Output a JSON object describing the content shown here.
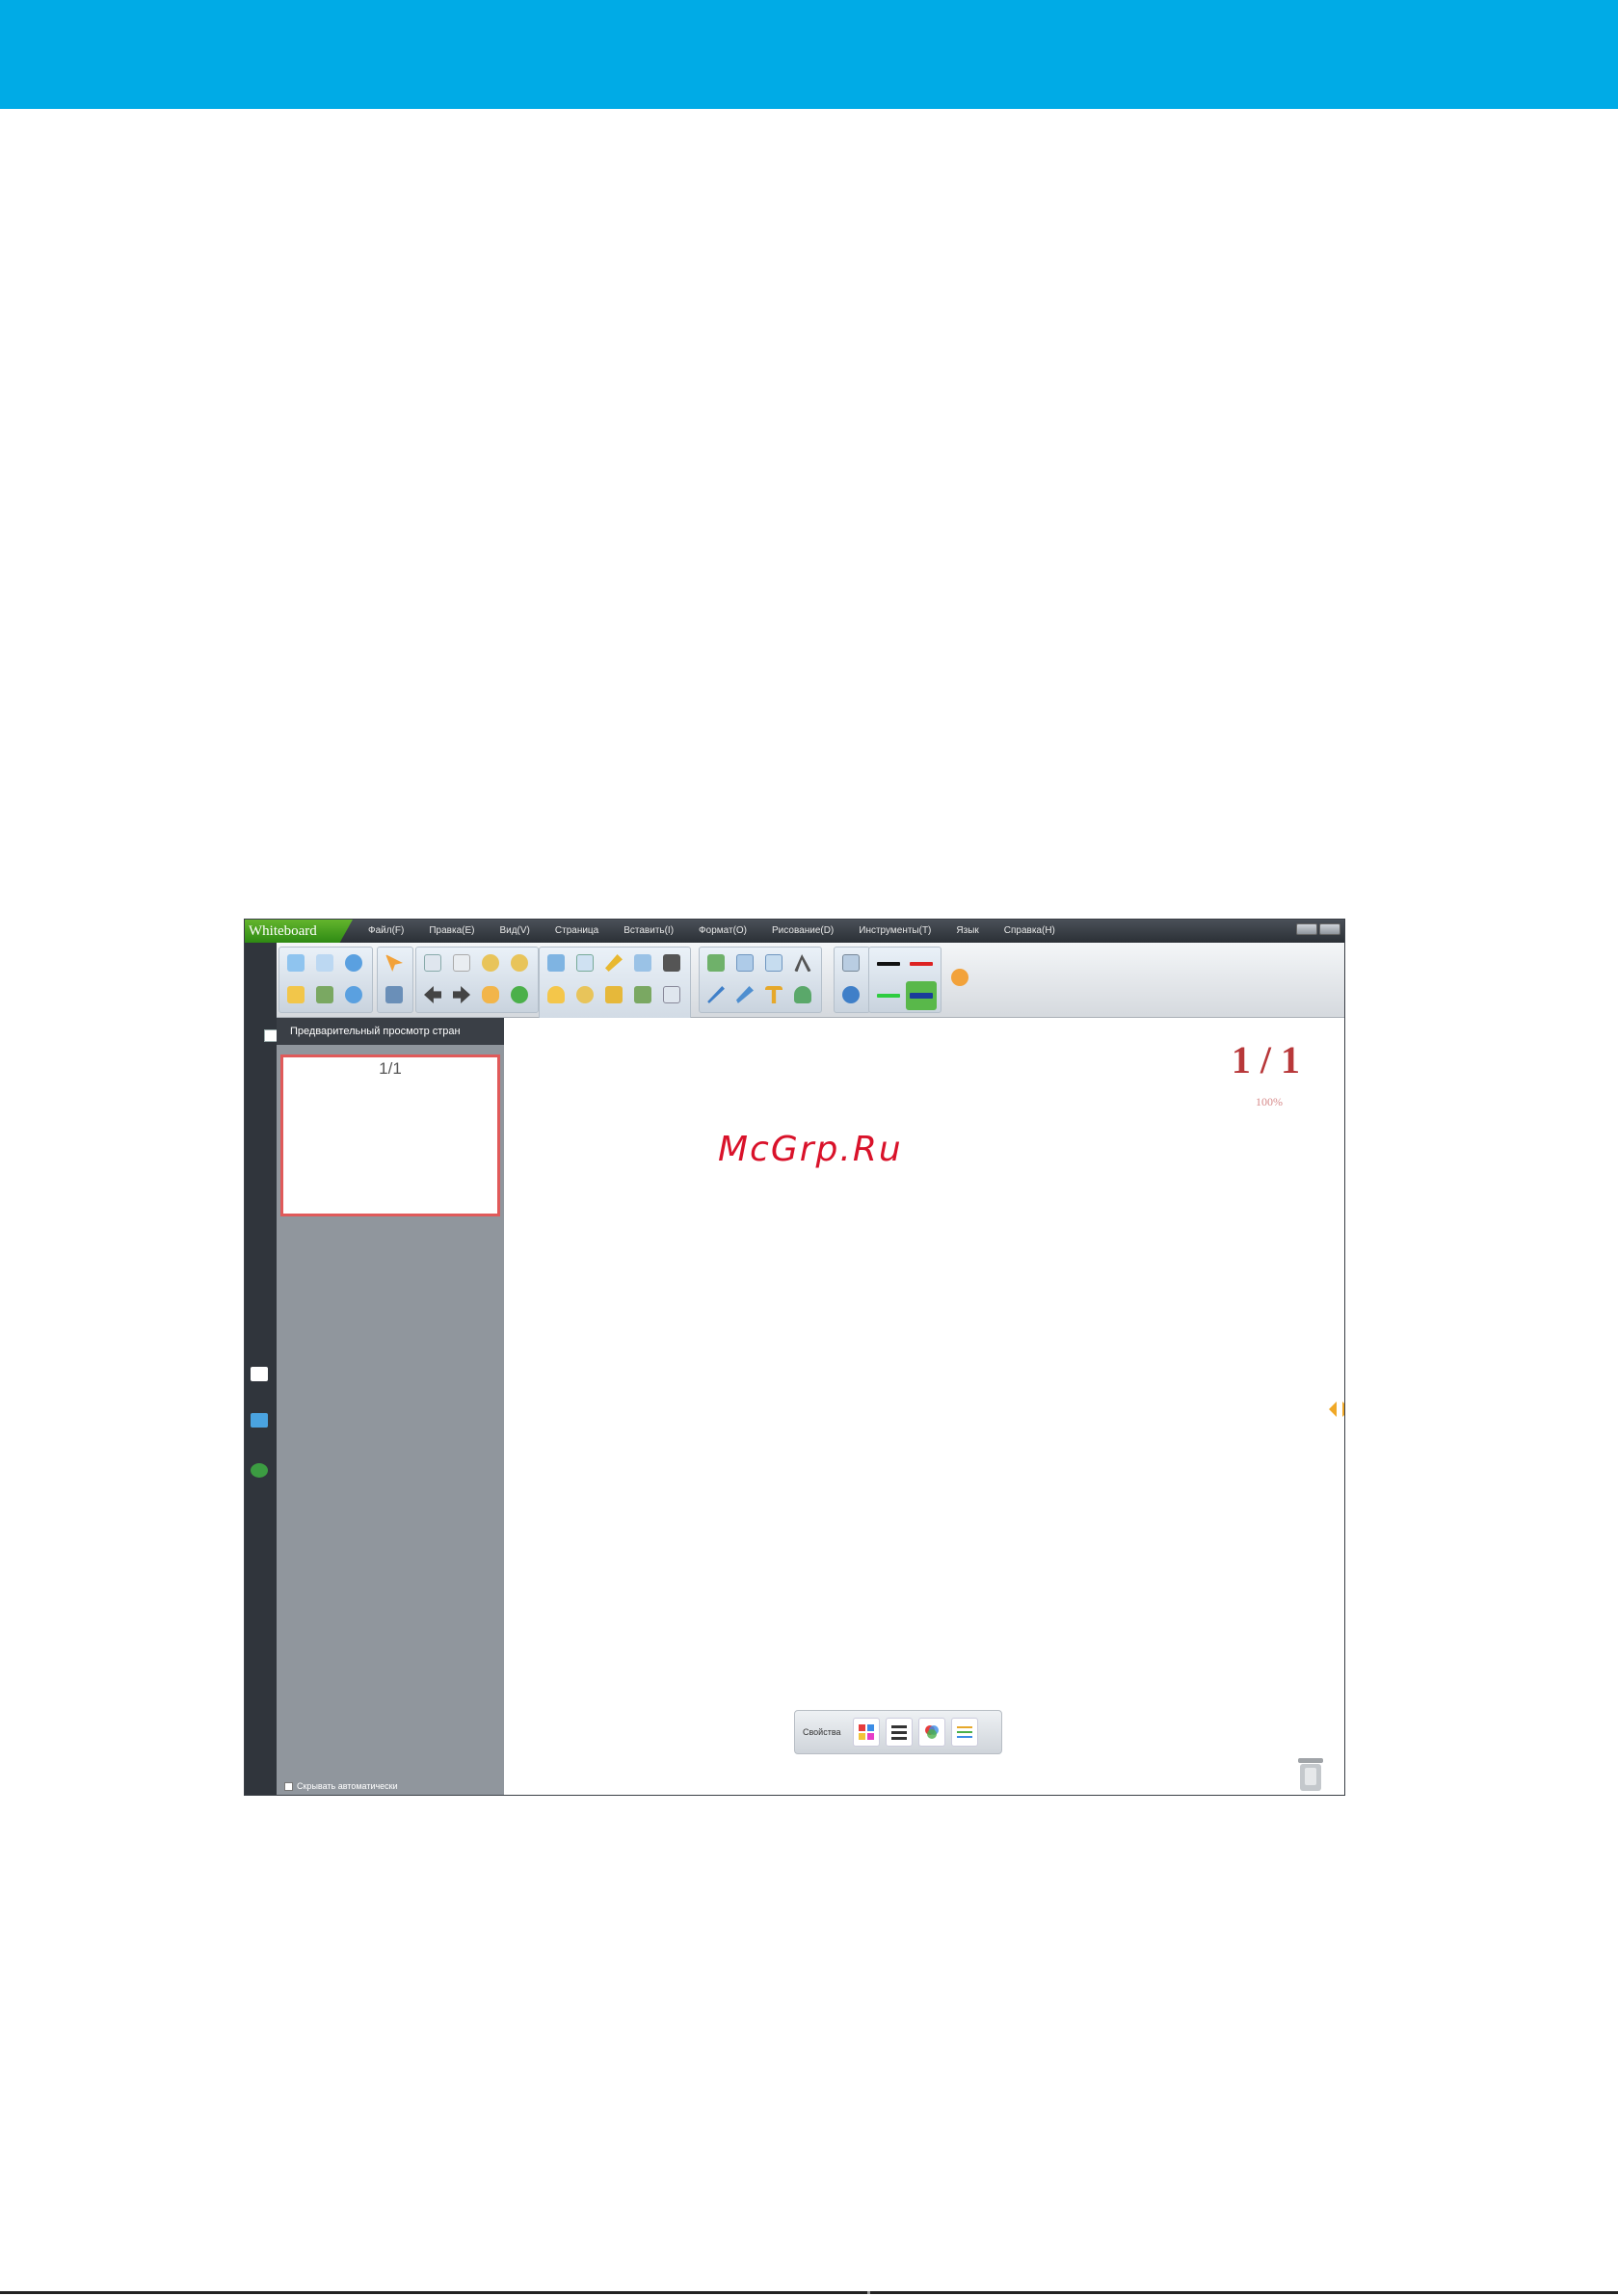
{
  "watermark": "McGrp.Ru",
  "app": {
    "brand": "Whiteboard",
    "menu": [
      "Файл(F)",
      "Правка(E)",
      "Вид(V)",
      "Страница",
      "Вставить(I)",
      "Формат(O)",
      "Рисование(D)",
      "Инструменты(T)",
      "Язык",
      "Справка(H)"
    ],
    "preview_title": "Предварительный просмотр стран",
    "thumbnail_label": "1/1",
    "autohide_label": "Скрывать автоматически",
    "page_count": "1 / 1",
    "zoom": "100%",
    "properties_label": "Свойства"
  },
  "colors": {
    "banner": "#00abe6",
    "watermark": "#d9122a",
    "brand_green": "#2e8a13",
    "page_count": "#b8383a",
    "preview_panel": "#90969d",
    "thumb_border": "#e05a5a"
  },
  "icons": {
    "toolbar": [
      "open-file-icon",
      "copy-icon",
      "undo-icon",
      "save-icon",
      "paste-icon",
      "redo-icon",
      "select-arrow-icon",
      "screen-icon",
      "new-page-icon",
      "delete-page-icon",
      "zoom-in-icon",
      "zoom-out-icon",
      "previous-page-icon",
      "next-page-icon",
      "hand-icon",
      "play-icon",
      "screen-capture-icon",
      "fullscreen-icon",
      "highlighter-icon",
      "screen-shade-icon",
      "video-icon",
      "spotlight-icon",
      "magnifier-icon",
      "camera-icon",
      "recorder-icon",
      "calendar-icon",
      "clock-icon",
      "eraser-icon",
      "link-icon",
      "shapes-icon",
      "rectangle-icon",
      "ruler-icon",
      "pen-icon",
      "brush-icon",
      "text-icon",
      "user-icon",
      "extra-tools-icon"
    ]
  }
}
